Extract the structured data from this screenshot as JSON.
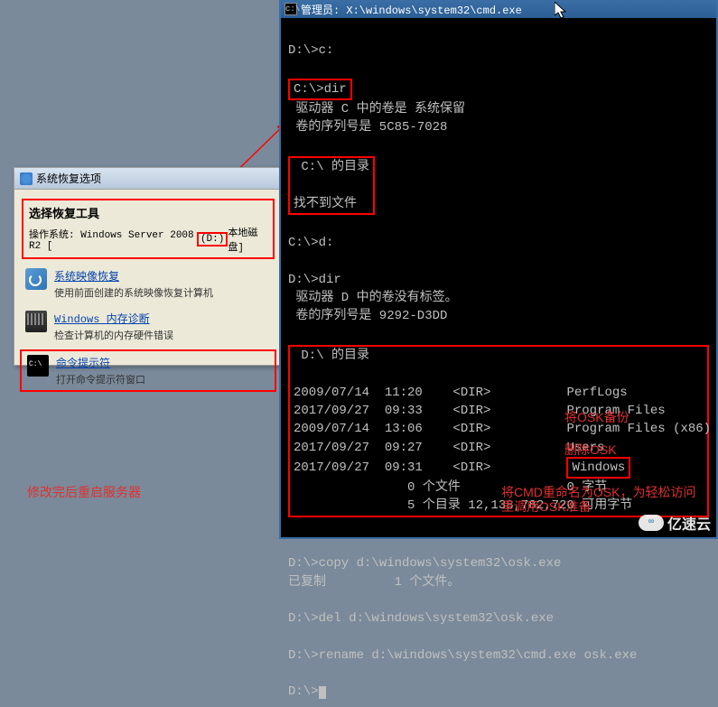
{
  "recovery": {
    "window_title": "系统恢复选项",
    "heading": "选择恢复工具",
    "os_label_prefix": "操作系统: Windows Server 2008 R2 [",
    "os_drive": "(D:)",
    "os_label_suffix": "本地磁盘]",
    "items": [
      {
        "link": "系统映像恢复",
        "desc": "使用前面创建的系统映像恢复计算机"
      },
      {
        "link": "Windows 内存诊断",
        "desc": "检查计算机的内存硬件错误"
      },
      {
        "link": "命令提示符",
        "desc": "打开命令提示符窗口"
      }
    ]
  },
  "cmd": {
    "title": "管理员: X:\\windows\\system32\\cmd.exe",
    "lines": {
      "l0": "D:\\>c:",
      "l1": "C:\\>dir",
      "l2": " 驱动器 C 中的卷是 系统保留",
      "l3": " 卷的序列号是 5C85-7028",
      "l4": " C:\\ 的目录",
      "l5": "找不到文件",
      "l6": "C:\\>d:",
      "l7": "D:\\>dir",
      "l8": " 驱动器 D 中的卷没有标签。",
      "l9": " 卷的序列号是 9292-D3DD",
      "l10": " D:\\ 的目录",
      "d1": "2009/07/14  11:20    <DIR>          PerfLogs",
      "d2": "2017/09/27  09:33    <DIR>          Program Files",
      "d3": "2009/07/14  13:06    <DIR>          Program Files (x86)",
      "d4": "2017/09/27  09:27    <DIR>          Users",
      "d5a": "2017/09/27  09:31    <DIR>          ",
      "d5b": "Windows",
      "s1": "               0 个文件              0 字节",
      "s2": "               5 个目录 12,138,782,720 可用字节",
      "c1": "D:\\>copy d:\\windows\\system32\\osk.exe",
      "c2": "已复制         1 个文件。",
      "c3": "D:\\>del d:\\windows\\system32\\osk.exe",
      "c4": "D:\\>rename d:\\windows\\system32\\cmd.exe osk.exe",
      "c5": "D:\\>"
    }
  },
  "annotations": {
    "reboot": "修改完后重启服务器",
    "backup_osk": "将OSK备份",
    "delete_osk": "删除OSK",
    "rename_line1": "将CMD重命名为OSK，为轻松访问",
    "rename_line2": "里调用OSK准备"
  },
  "watermark": "亿速云"
}
